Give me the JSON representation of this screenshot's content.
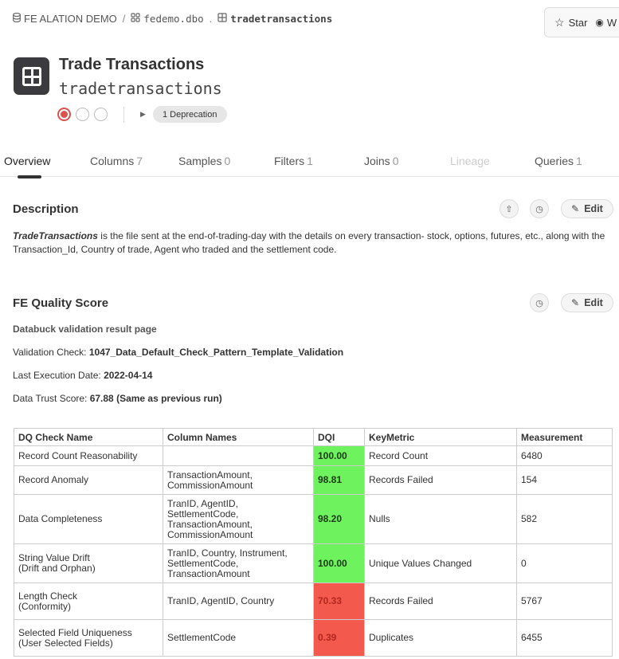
{
  "breadcrumb": {
    "datasource": "FE ALATION DEMO",
    "schema": "fedemo.dbo",
    "table": "tradetransactions"
  },
  "top_actions": {
    "star": "Star",
    "watch": "W"
  },
  "header": {
    "title": "Trade Transactions",
    "name": "tradetransactions",
    "deprecation": "1 Deprecation"
  },
  "tabs": [
    {
      "label": "Overview",
      "count": ""
    },
    {
      "label": "Columns",
      "count": "7"
    },
    {
      "label": "Samples",
      "count": "0"
    },
    {
      "label": "Filters",
      "count": "1"
    },
    {
      "label": "Joins",
      "count": "0"
    },
    {
      "label": "Lineage",
      "count": ""
    },
    {
      "label": "Queries",
      "count": "1"
    }
  ],
  "description": {
    "heading": "Description",
    "edit": "Edit",
    "emphasis": "TradeTransactions",
    "text": " is the file sent at the end-of-trading-day with the details on every transaction- stock, options, futures, etc., along with the Transaction_Id, Country of trade, Agent who traded and the settlement code."
  },
  "quality": {
    "heading": "FE Quality Score",
    "edit": "Edit",
    "subheading": "Databuck validation result page",
    "validation_label": "Validation Check: ",
    "validation_value": "1047_Data_Default_Check_Pattern_Template_Validation",
    "date_label": "Last Execution Date: ",
    "date_value": "2022-04-14",
    "score_label": "Data Trust Score: ",
    "score_value": "67.88 (Same as previous run)"
  },
  "dq_table": {
    "headers": [
      "DQ Check Name",
      "Column Names",
      "DQI",
      "KeyMetric",
      "Measurement"
    ],
    "rows": [
      {
        "check": "Record Count Reasonability",
        "check2": "",
        "columns": "",
        "dqi": "100.00",
        "metric": "Record Count",
        "measure": "6480",
        "status": "pass"
      },
      {
        "check": "Record Anomaly",
        "check2": "",
        "columns": "TransactionAmount, CommissionAmount",
        "dqi": "98.81",
        "metric": "Records Failed",
        "measure": "154",
        "status": "pass"
      },
      {
        "check": "Data Completeness",
        "check2": "",
        "columns": "TranID, AgentID, SettlementCode, TransactionAmount, CommissionAmount",
        "dqi": "98.20",
        "metric": "Nulls",
        "measure": "582",
        "status": "pass"
      },
      {
        "check": "String Value Drift",
        "check2": "(Drift and Orphan)",
        "columns": "TranID, Country, Instrument, SettlementCode, TransactionAmount",
        "dqi": "100.00",
        "metric": "Unique Values Changed",
        "measure": "0",
        "status": "pass"
      },
      {
        "check": "Length Check",
        "check2": "(Conformity)",
        "columns": "TranID, AgentID, Country",
        "dqi": "70.33",
        "metric": "Records Failed",
        "measure": "5767",
        "status": "fail"
      },
      {
        "check": "Selected Field Uniqueness",
        "check2": "(User Selected Fields)",
        "columns": "SettlementCode",
        "dqi": "0.39",
        "metric": "Duplicates",
        "measure": "6455",
        "status": "fail"
      }
    ]
  },
  "colors": {
    "pass": "#6ef25e",
    "fail": "#f4594d",
    "fail_text": "#b3261e"
  }
}
